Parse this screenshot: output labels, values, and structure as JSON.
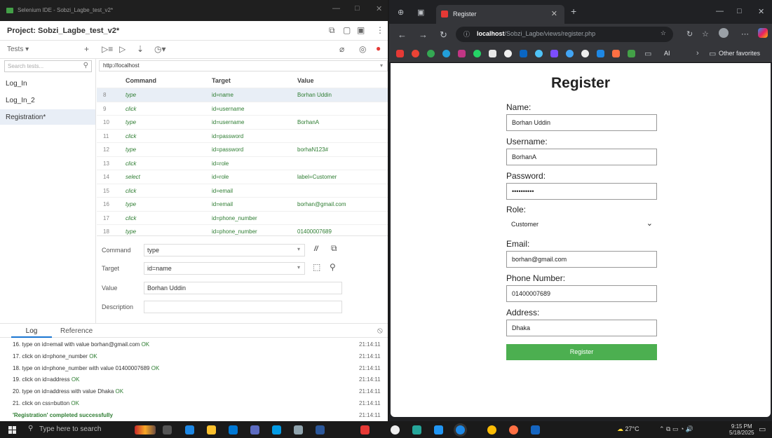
{
  "ide": {
    "window_title": "Selenium IDE - Sobzi_Lagbe_test_v2*",
    "project_title": "Project:  Sobzi_Lagbe_test_v2*",
    "tests_label": "Tests",
    "search_placeholder": "Search tests...",
    "tests": [
      "Log_In",
      "Log_In_2",
      "Registration*"
    ],
    "active_test": "Registration*",
    "base_url": "http://localhost",
    "columns": {
      "command": "Command",
      "target": "Target",
      "value": "Value"
    },
    "rows": [
      {
        "num": "8",
        "command": "type",
        "target": "id=name",
        "value": "Borhan Uddin",
        "selected": true
      },
      {
        "num": "9",
        "command": "click",
        "target": "id=username",
        "value": ""
      },
      {
        "num": "10",
        "command": "type",
        "target": "id=username",
        "value": "BorhanA"
      },
      {
        "num": "11",
        "command": "click",
        "target": "id=password",
        "value": ""
      },
      {
        "num": "12",
        "command": "type",
        "target": "id=password",
        "value": "borhaN123#"
      },
      {
        "num": "13",
        "command": "click",
        "target": "id=role",
        "value": ""
      },
      {
        "num": "14",
        "command": "select",
        "target": "id=role",
        "value": "label=Customer"
      },
      {
        "num": "15",
        "command": "click",
        "target": "id=email",
        "value": ""
      },
      {
        "num": "16",
        "command": "type",
        "target": "id=email",
        "value": "borhan@gmail.com"
      },
      {
        "num": "17",
        "command": "click",
        "target": "id=phone_number",
        "value": ""
      },
      {
        "num": "18",
        "command": "type",
        "target": "id=phone_number",
        "value": "01400007689"
      }
    ],
    "editor": {
      "command_label": "Command",
      "command_value": "type",
      "target_label": "Target",
      "target_value": "id=name",
      "value_label": "Value",
      "value_value": "Borhan Uddin",
      "description_label": "Description",
      "description_value": ""
    },
    "log_tabs": {
      "log": "Log",
      "reference": "Reference"
    },
    "log": [
      {
        "text": "16. type on id=email with value borhan@gmail.com",
        "status": "OK",
        "time": "21:14:11"
      },
      {
        "text": "17. click on id=phone_number",
        "status": "OK",
        "time": "21:14:11"
      },
      {
        "text": "18. type on id=phone_number with value 01400007689",
        "status": "OK",
        "time": "21:14:11"
      },
      {
        "text": "19. click on id=address",
        "status": "OK",
        "time": "21:14:11"
      },
      {
        "text": "20. type on id=address with value Dhaka",
        "status": "OK",
        "time": "21:14:11"
      },
      {
        "text": "21. click on css=button",
        "status": "OK",
        "time": "21:14:11"
      }
    ],
    "log_completed": "'Registration' completed successfully",
    "log_completed_time": "21:14:11"
  },
  "browser": {
    "tab_title": "Register",
    "url_host": "localhost",
    "url_path": "/Sobzi_Lagbe/views/register.php",
    "bookmark_ai": "AI",
    "bookmark_other": "Other favorites",
    "page": {
      "title": "Register",
      "fields": [
        {
          "label": "Name:",
          "value": "Borhan Uddin"
        },
        {
          "label": "Username:",
          "value": "BorhanA"
        },
        {
          "label": "Password:",
          "value": "••••••••••"
        },
        {
          "label": "Role:",
          "value": "Customer"
        },
        {
          "label": "Email:",
          "value": "borhan@gmail.com"
        },
        {
          "label": "Phone Number:",
          "value": "01400007689"
        },
        {
          "label": "Address:",
          "value": "Dhaka"
        }
      ],
      "submit_label": "Register"
    }
  },
  "taskbar": {
    "search_placeholder": "Type here to search",
    "weather": "27°C",
    "time": "9:15 PM",
    "date": "5/18/2025"
  },
  "colors": {
    "selenium_green": "#43a047",
    "register_button": "#4caf50",
    "ok_green": "#2e7d32",
    "selected_row": "#e8eef6"
  }
}
